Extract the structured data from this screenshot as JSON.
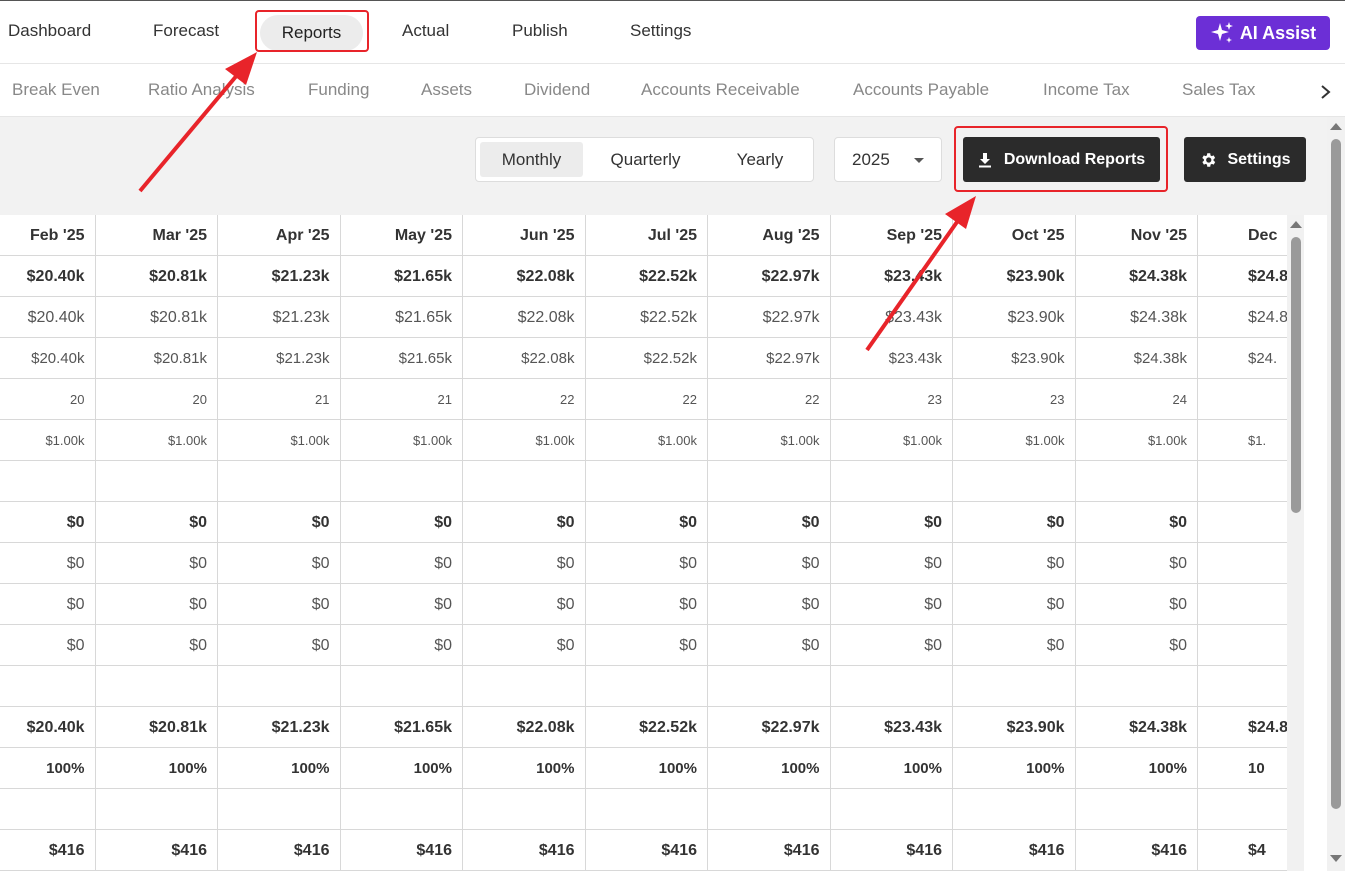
{
  "topnav": {
    "items": [
      "Dashboard",
      "Forecast",
      "Reports",
      "Actual",
      "Publish",
      "Settings"
    ],
    "active": "Reports",
    "ai_button": "AI Assist"
  },
  "subnav": {
    "items": [
      "Break Even",
      "Ratio Analysis",
      "Funding",
      "Assets",
      "Dividend",
      "Accounts Receivable",
      "Accounts Payable",
      "Income Tax",
      "Sales Tax"
    ]
  },
  "toolbar": {
    "periods": [
      "Monthly",
      "Quarterly",
      "Yearly"
    ],
    "selected_period": "Monthly",
    "year": "2025",
    "download_label": "Download Reports",
    "settings_label": "Settings"
  },
  "table": {
    "columns": [
      "Feb '25",
      "Mar '25",
      "Apr '25",
      "May '25",
      "Jun '25",
      "Jul '25",
      "Aug '25",
      "Sep '25",
      "Oct '25",
      "Nov '25",
      "Dec"
    ],
    "rows": [
      {
        "style": "bold",
        "values": [
          "$20.40k",
          "$20.81k",
          "$21.23k",
          "$21.65k",
          "$22.08k",
          "$22.52k",
          "$22.97k",
          "$23.43k",
          "$23.90k",
          "$24.38k",
          "$24.8"
        ]
      },
      {
        "style": "norm",
        "values": [
          "$20.40k",
          "$20.81k",
          "$21.23k",
          "$21.65k",
          "$22.08k",
          "$22.52k",
          "$22.97k",
          "$23.43k",
          "$23.90k",
          "$24.38k",
          "$24.8"
        ]
      },
      {
        "style": "small",
        "values": [
          "$20.40k",
          "$20.81k",
          "$21.23k",
          "$21.65k",
          "$22.08k",
          "$22.52k",
          "$22.97k",
          "$23.43k",
          "$23.90k",
          "$24.38k",
          "$24."
        ]
      },
      {
        "style": "tiny",
        "values": [
          "20",
          "20",
          "21",
          "21",
          "22",
          "22",
          "22",
          "23",
          "23",
          "24",
          ""
        ]
      },
      {
        "style": "tiny",
        "values": [
          "$1.00k",
          "$1.00k",
          "$1.00k",
          "$1.00k",
          "$1.00k",
          "$1.00k",
          "$1.00k",
          "$1.00k",
          "$1.00k",
          "$1.00k",
          "$1."
        ]
      },
      {
        "style": "norm",
        "values": [
          "",
          "",
          "",
          "",
          "",
          "",
          "",
          "",
          "",
          "",
          ""
        ]
      },
      {
        "style": "bold",
        "values": [
          "$0",
          "$0",
          "$0",
          "$0",
          "$0",
          "$0",
          "$0",
          "$0",
          "$0",
          "$0",
          ""
        ]
      },
      {
        "style": "norm",
        "values": [
          "$0",
          "$0",
          "$0",
          "$0",
          "$0",
          "$0",
          "$0",
          "$0",
          "$0",
          "$0",
          ""
        ]
      },
      {
        "style": "norm",
        "values": [
          "$0",
          "$0",
          "$0",
          "$0",
          "$0",
          "$0",
          "$0",
          "$0",
          "$0",
          "$0",
          ""
        ]
      },
      {
        "style": "norm",
        "values": [
          "$0",
          "$0",
          "$0",
          "$0",
          "$0",
          "$0",
          "$0",
          "$0",
          "$0",
          "$0",
          ""
        ]
      },
      {
        "style": "norm",
        "values": [
          "",
          "",
          "",
          "",
          "",
          "",
          "",
          "",
          "",
          "",
          ""
        ]
      },
      {
        "style": "bold",
        "values": [
          "$20.40k",
          "$20.81k",
          "$21.23k",
          "$21.65k",
          "$22.08k",
          "$22.52k",
          "$22.97k",
          "$23.43k",
          "$23.90k",
          "$24.38k",
          "$24.8"
        ]
      },
      {
        "style": "pct",
        "values": [
          "100%",
          "100%",
          "100%",
          "100%",
          "100%",
          "100%",
          "100%",
          "100%",
          "100%",
          "100%",
          "10"
        ]
      },
      {
        "style": "norm",
        "values": [
          "",
          "",
          "",
          "",
          "",
          "",
          "",
          "",
          "",
          "",
          ""
        ]
      },
      {
        "style": "bold",
        "values": [
          "$416",
          "$416",
          "$416",
          "$416",
          "$416",
          "$416",
          "$416",
          "$416",
          "$416",
          "$416",
          "$4"
        ]
      }
    ]
  },
  "colors": {
    "highlight": "#e8242a",
    "ai_button": "#6c2fd6",
    "dark_button": "#2b2b2b"
  }
}
